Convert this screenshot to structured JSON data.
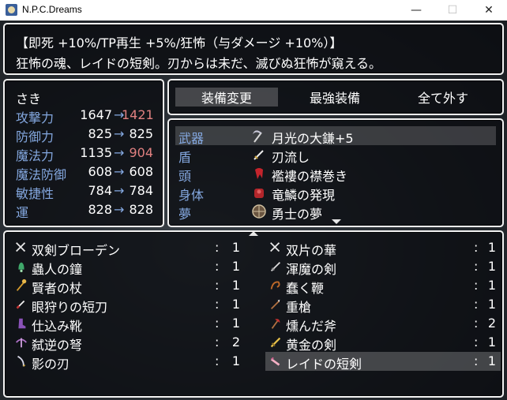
{
  "window": {
    "title": "N.P.C.Dreams",
    "minimize": "—",
    "maximize": "☐",
    "close": "✕"
  },
  "help": {
    "line1": "【即死 +10%/TP再生 +5%/狂怖（与ダメージ +10%）】",
    "line2": "狂怖の魂、レイドの短剣。刃からは未だ、滅びぬ狂怖が窺える。"
  },
  "status": {
    "actor_name": "さき",
    "stats": [
      {
        "label": "攻撃力",
        "current": "1647",
        "arrow": "→",
        "new": "1421",
        "change": "down"
      },
      {
        "label": "防御力",
        "current": "825",
        "arrow": "→",
        "new": "825",
        "change": "same"
      },
      {
        "label": "魔法力",
        "current": "1135",
        "arrow": "→",
        "new": "904",
        "change": "down"
      },
      {
        "label": "魔法防御",
        "current": "608",
        "arrow": "→",
        "new": "608",
        "change": "same"
      },
      {
        "label": "敏捷性",
        "current": "784",
        "arrow": "→",
        "new": "784",
        "change": "same"
      },
      {
        "label": "運",
        "current": "828",
        "arrow": "→",
        "new": "828",
        "change": "same"
      }
    ]
  },
  "commands": {
    "equip": "装備変更",
    "optimize": "最強装備",
    "clear": "全て外す"
  },
  "slots": [
    {
      "slot": "武器",
      "item": "月光の大鎌+5",
      "icon": "scythe-icon"
    },
    {
      "slot": "盾",
      "item": "刃流し",
      "icon": "dagger-icon"
    },
    {
      "slot": "頭",
      "item": "襤褸の襟巻き",
      "icon": "scarf-icon"
    },
    {
      "slot": "身体",
      "item": "竜鱗の発現",
      "icon": "dragon-armor-icon"
    },
    {
      "slot": "夢",
      "item": "勇士の夢",
      "icon": "medallion-icon"
    }
  ],
  "items_left": [
    {
      "name": "双剣ブローデン",
      "count": "1",
      "icon": "twin-swords-icon"
    },
    {
      "name": "蟲人の鐘",
      "count": "1",
      "icon": "bell-icon"
    },
    {
      "name": "賢者の杖",
      "count": "1",
      "icon": "staff-icon"
    },
    {
      "name": "眼狩りの短刀",
      "count": "1",
      "icon": "short-blade-icon"
    },
    {
      "name": "仕込み靴",
      "count": "1",
      "icon": "boot-icon"
    },
    {
      "name": "弑逆の弩",
      "count": "2",
      "icon": "crossbow-icon"
    },
    {
      "name": "影の刃",
      "count": "1",
      "icon": "shadow-blade-icon"
    }
  ],
  "items_right": [
    {
      "name": "双片の華",
      "count": "1",
      "icon": "twin-swords-icon"
    },
    {
      "name": "渾魔の剣",
      "count": "1",
      "icon": "sword-icon"
    },
    {
      "name": "蠢く鞭",
      "count": "1",
      "icon": "whip-icon"
    },
    {
      "name": "重槍",
      "count": "1",
      "icon": "spear-icon"
    },
    {
      "name": "燻んだ斧",
      "count": "2",
      "icon": "axe-icon"
    },
    {
      "name": "黄金の剣",
      "count": "1",
      "icon": "golden-sword-icon"
    },
    {
      "name": "レイドの短剣",
      "count": "1",
      "icon": "raid-dagger-icon"
    }
  ],
  "colon": ":",
  "colors": {
    "system_blue": "#84a8e0",
    "stat_down": "#e08080",
    "window_border": "#f2f2f2"
  }
}
